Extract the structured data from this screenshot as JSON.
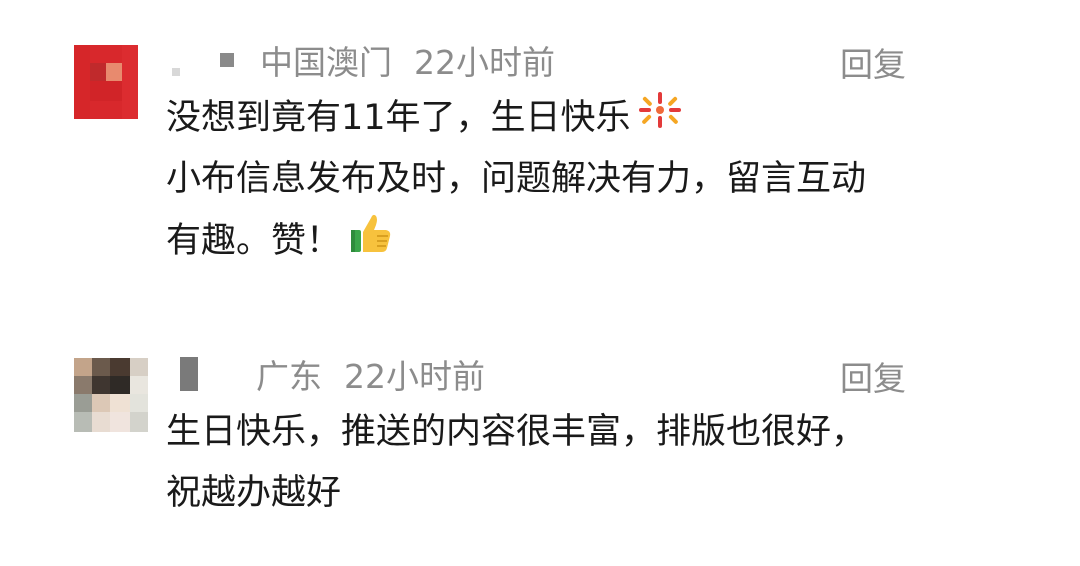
{
  "comments": [
    {
      "location": "中国澳门",
      "time": "22小时前",
      "reply_label": "回复",
      "lines": [
        "没想到竟有11年了，生日快乐",
        "小布信息发布及时，问题解决有力，留言互动",
        "有趣。赞！"
      ],
      "emojis": [
        "fireworks-icon",
        "thumbs-up-icon"
      ]
    },
    {
      "location": "广东",
      "time": "22小时前",
      "reply_label": "回复",
      "lines": [
        "生日快乐，推送的内容很丰富，排版也很好，",
        "祝越办越好"
      ]
    }
  ],
  "colors": {
    "meta_text": "#8c8c8c",
    "body_text": "#1a1a1a",
    "avatar1_main": "#d8282c",
    "avatar2_main": "#e8e0d6"
  }
}
